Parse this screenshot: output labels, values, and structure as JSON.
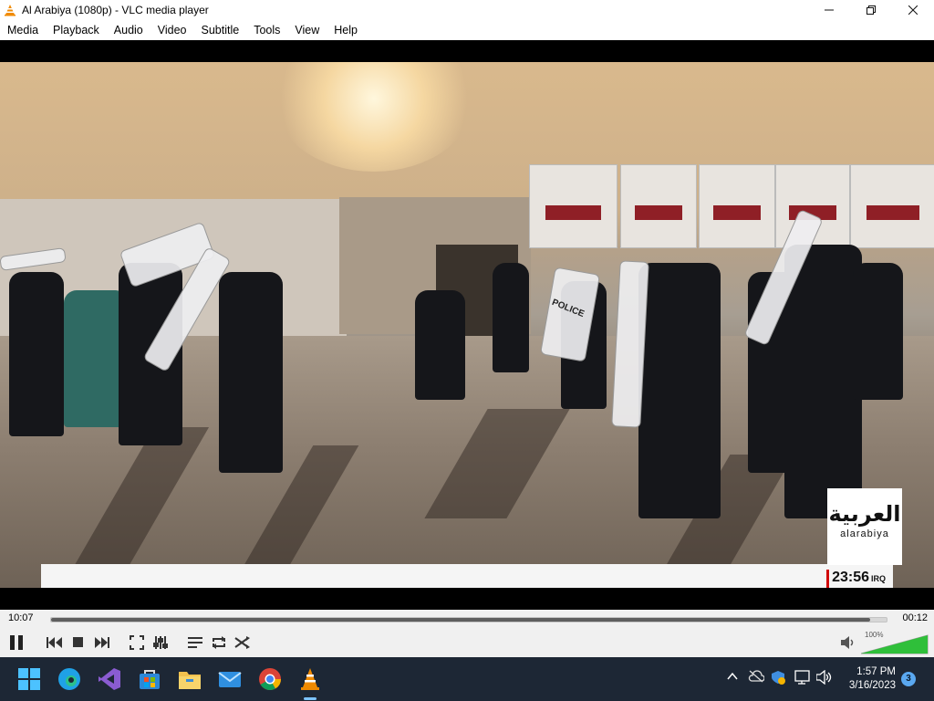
{
  "window": {
    "title": "Al Arabiya (1080p) - VLC media player"
  },
  "menu": [
    "Media",
    "Playback",
    "Audio",
    "Video",
    "Subtitle",
    "Tools",
    "View",
    "Help"
  ],
  "video": {
    "channel_logo_ar": "العربية",
    "channel_logo_en": "alarabiya",
    "clock": "23:56",
    "clock_zone": "IRQ",
    "shield_text": "POLICE"
  },
  "player": {
    "elapsed": "10:07",
    "remaining": "00:12",
    "progress_fraction": 0.98,
    "volume": "100%",
    "volume_fraction": 1.0
  },
  "taskbar": {
    "time": "1:57 PM",
    "date": "3/16/2023",
    "notifications": "3",
    "apps": [
      "start-icon",
      "edge-icon",
      "visual-studio-icon",
      "store-icon",
      "file-explorer-icon",
      "mail-icon",
      "chrome-icon",
      "vlc-icon"
    ],
    "active_app": "vlc-icon"
  },
  "colors": {
    "accent_progress": "#5e5e5e",
    "taskbar_bg": "#1d2735",
    "volume_green": "#2fbf3a",
    "logo_red": "#d10a0a"
  }
}
